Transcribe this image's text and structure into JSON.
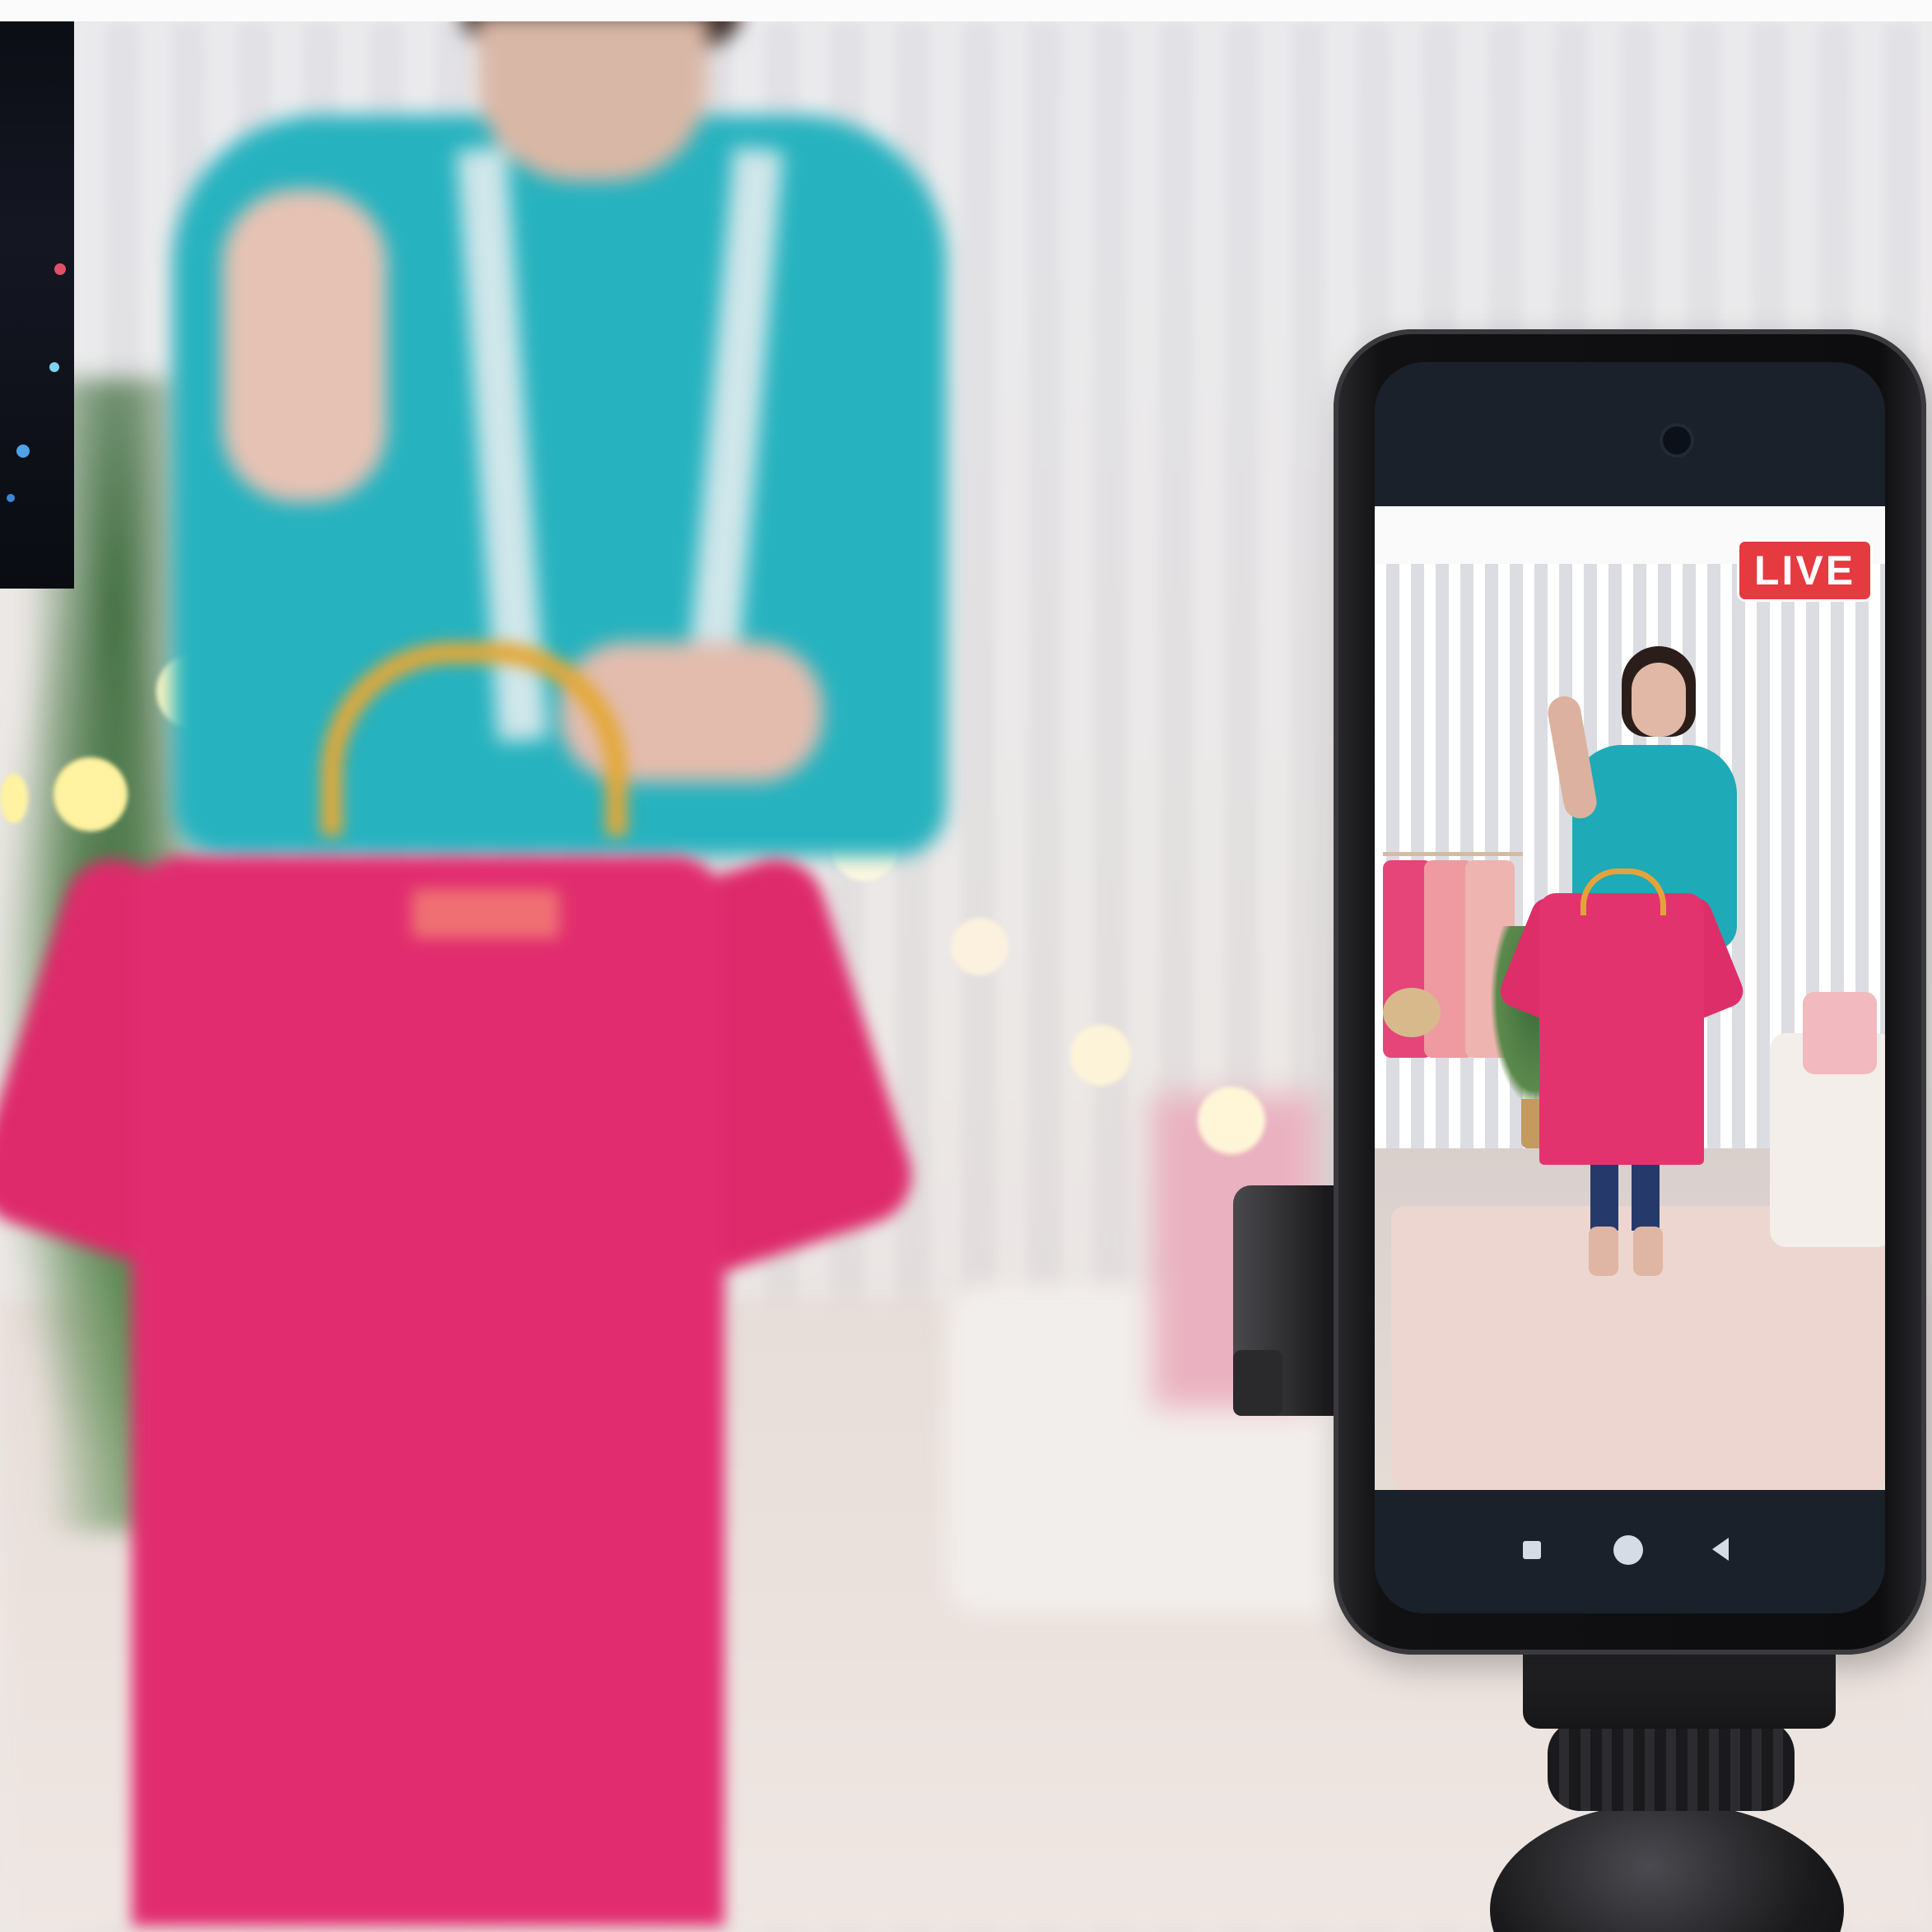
{
  "phone_screen": {
    "live_badge": "LIVE"
  },
  "phone_nav": {
    "buttons": [
      "recent-apps-icon",
      "home-icon",
      "back-icon"
    ]
  },
  "colors": {
    "live_red": "#e53a3f",
    "tshirt_pink": "#e12d6f",
    "sweater_teal": "#26b2bf",
    "hanger_gold": "#e3a838",
    "phone_body": "#111113"
  }
}
